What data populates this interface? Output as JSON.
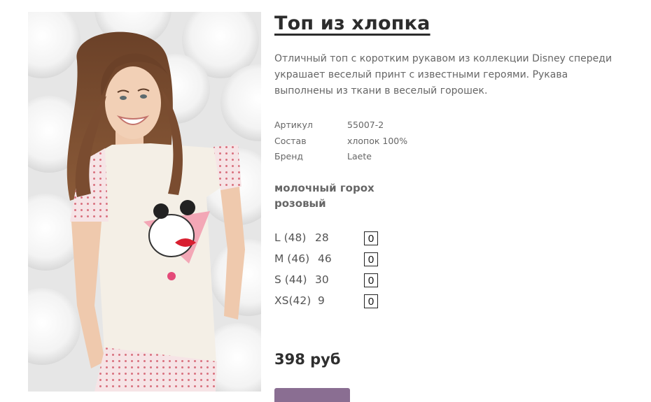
{
  "product": {
    "title": "Топ из хлопка",
    "description": "Отличный топ с коротким рукавом из коллекции Disney спереди украшает веселый принт с известными героями. Рукава выполнены из ткани в веселый горошек.",
    "specs": [
      {
        "label": "Артикул",
        "value": "55007-2"
      },
      {
        "label": "Состав",
        "value": "хлопок 100%"
      },
      {
        "label": "Бренд",
        "value": "Laete"
      }
    ],
    "colors": [
      "молочный горох",
      "розовый"
    ],
    "sizes": [
      {
        "label": "L (48)",
        "stock": "28",
        "qty": "0"
      },
      {
        "label": "M (46)",
        "stock": "46",
        "qty": "0"
      },
      {
        "label": "S (44)",
        "stock": "30",
        "qty": "0"
      },
      {
        "label": "XS(42)",
        "stock": "9",
        "qty": "0"
      }
    ],
    "price": "398 руб"
  },
  "colors": {
    "title": "#2c2c2c",
    "text": "#666666",
    "button": "#8a6e92"
  }
}
